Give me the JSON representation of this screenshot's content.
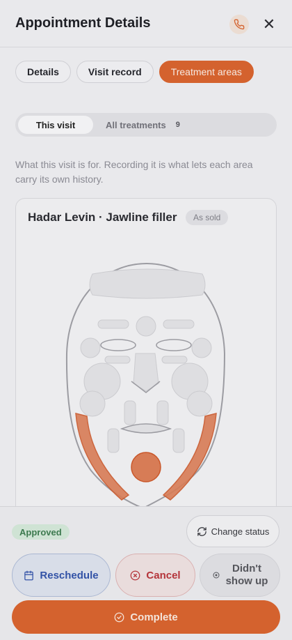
{
  "header": {
    "title": "Appointment Details",
    "phone_icon": "phone-icon",
    "close_icon": "close-icon",
    "close_glyph": "✕"
  },
  "tabs": [
    {
      "label": "Details",
      "active": false
    },
    {
      "label": "Visit record",
      "active": false
    },
    {
      "label": "Treatment areas",
      "active": true
    }
  ],
  "segment": {
    "this_visit": "This visit",
    "all_treatments": "All treatments",
    "all_treatments_count": "9"
  },
  "description": "What this visit is for. Recording it is what lets each area carry its own history.",
  "card": {
    "title": "Hadar Levin · Jawline filler",
    "badge": "As sold",
    "highlighted_areas": [
      "left-jawline",
      "right-jawline",
      "chin"
    ]
  },
  "footer": {
    "status_badge": "Approved",
    "change_status": "Change status",
    "reschedule": "Reschedule",
    "cancel": "Cancel",
    "no_show_line1": "Didn't",
    "no_show_line2": "show up",
    "complete": "Complete"
  },
  "colors": {
    "accent": "#d4622e",
    "approved": "#3d7a4f",
    "reschedule": "#3252a6",
    "cancel": "#b4343a"
  }
}
